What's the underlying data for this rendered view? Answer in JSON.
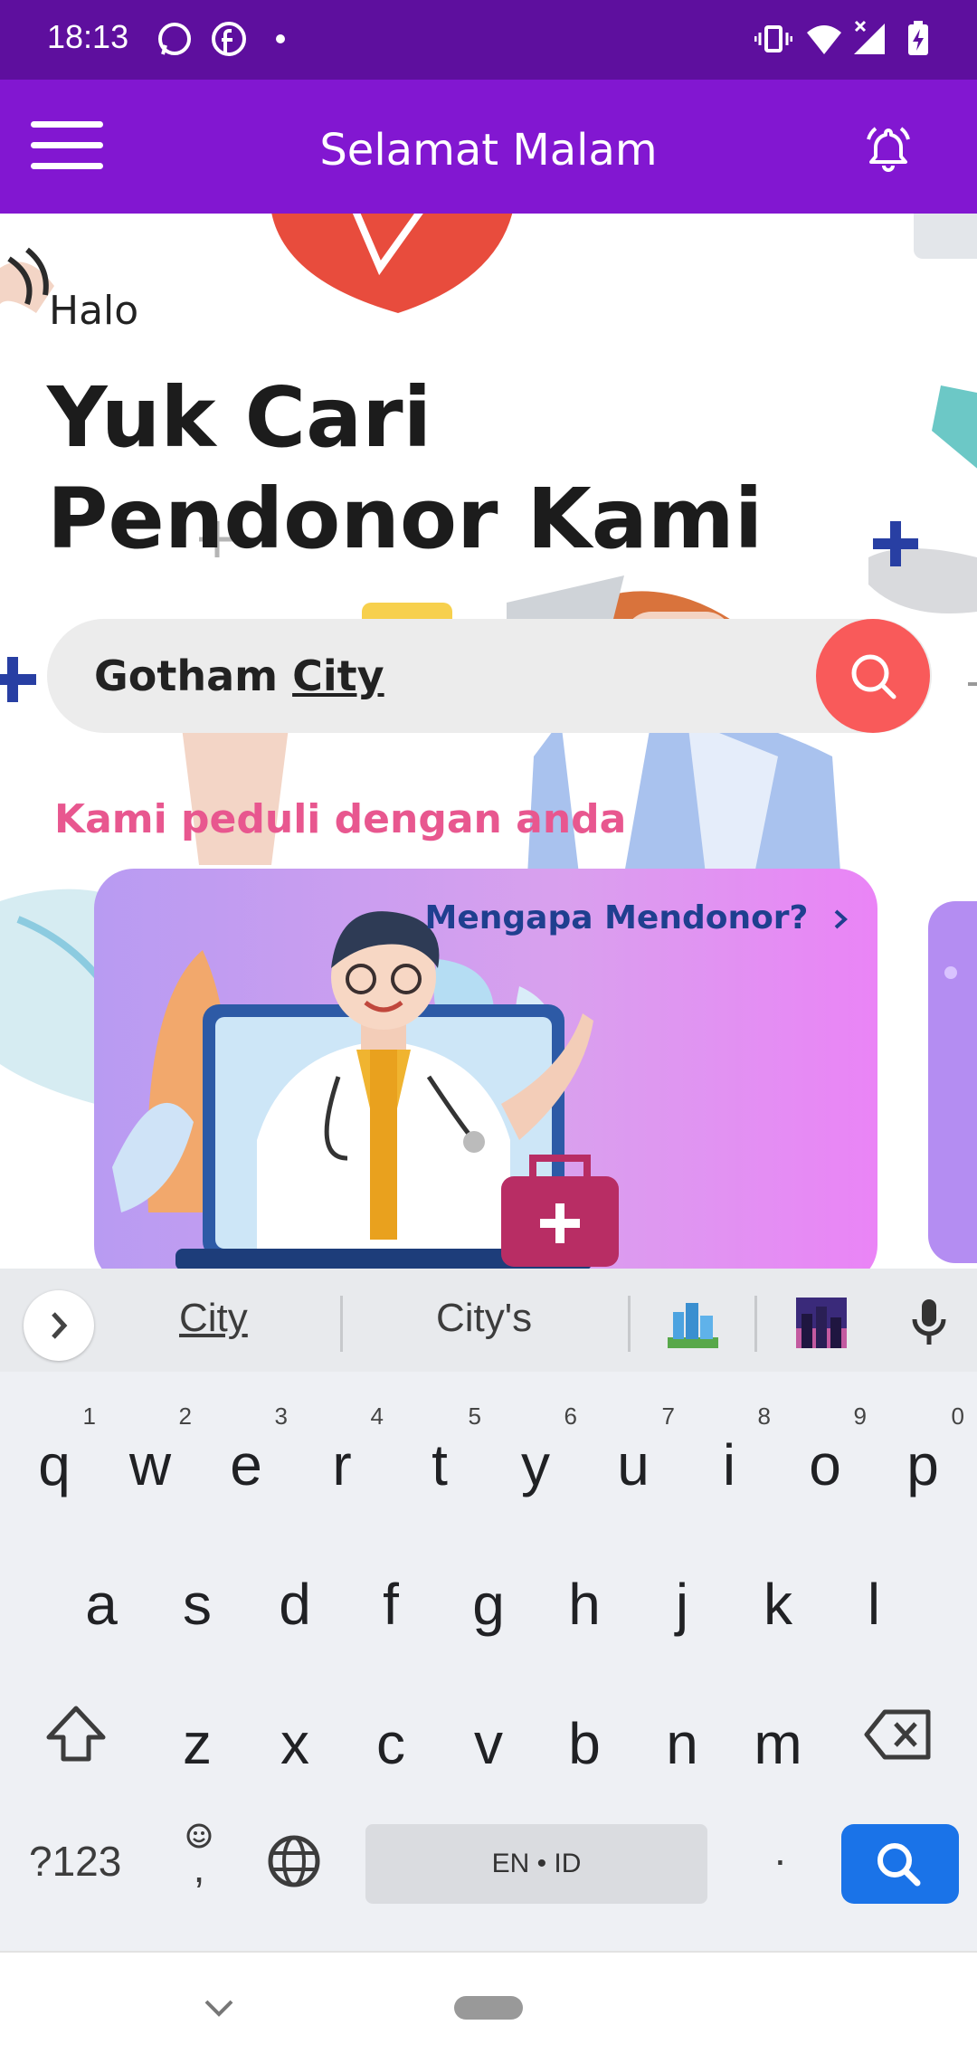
{
  "status_bar": {
    "time": "18:13",
    "notification_icons": [
      "whatsapp-icon",
      "facebook-icon",
      "dot-icon"
    ],
    "system_icons": [
      "vibrate-icon",
      "wifi-icon",
      "signal-icon",
      "battery-charging-icon"
    ]
  },
  "app_bar": {
    "title": "Selamat Malam",
    "menu_icon": "hamburger-menu-icon",
    "notification_icon": "bell-icon",
    "color": "#8217d1"
  },
  "main": {
    "greeting": "Halo",
    "headline": "Yuk Cari Pendonor Kami",
    "search": {
      "value_prefix": "Gotham ",
      "value_underlined": "City",
      "button_icon": "search-icon",
      "button_color": "#f95a5a"
    },
    "care_label": "Kami peduli dengan anda",
    "card": {
      "link_label": "Mengapa Mendonor?",
      "link_icon": "chevron-right-icon"
    }
  },
  "keyboard": {
    "suggestions": [
      "City",
      "City's"
    ],
    "emoji_suggestions": [
      "cityscape-emoji",
      "night-city-emoji"
    ],
    "row1": [
      {
        "key": "q",
        "hint": "1"
      },
      {
        "key": "w",
        "hint": "2"
      },
      {
        "key": "e",
        "hint": "3"
      },
      {
        "key": "r",
        "hint": "4"
      },
      {
        "key": "t",
        "hint": "5"
      },
      {
        "key": "y",
        "hint": "6"
      },
      {
        "key": "u",
        "hint": "7"
      },
      {
        "key": "i",
        "hint": "8"
      },
      {
        "key": "o",
        "hint": "9"
      },
      {
        "key": "p",
        "hint": "0"
      }
    ],
    "row2": [
      "a",
      "s",
      "d",
      "f",
      "g",
      "h",
      "j",
      "k",
      "l"
    ],
    "row3": [
      "z",
      "x",
      "c",
      "v",
      "b",
      "n",
      "m"
    ],
    "symbols_label": "?123",
    "comma_label": ",",
    "space_label": "EN • ID",
    "period_label": ".",
    "enter_color": "#1a73e8"
  }
}
